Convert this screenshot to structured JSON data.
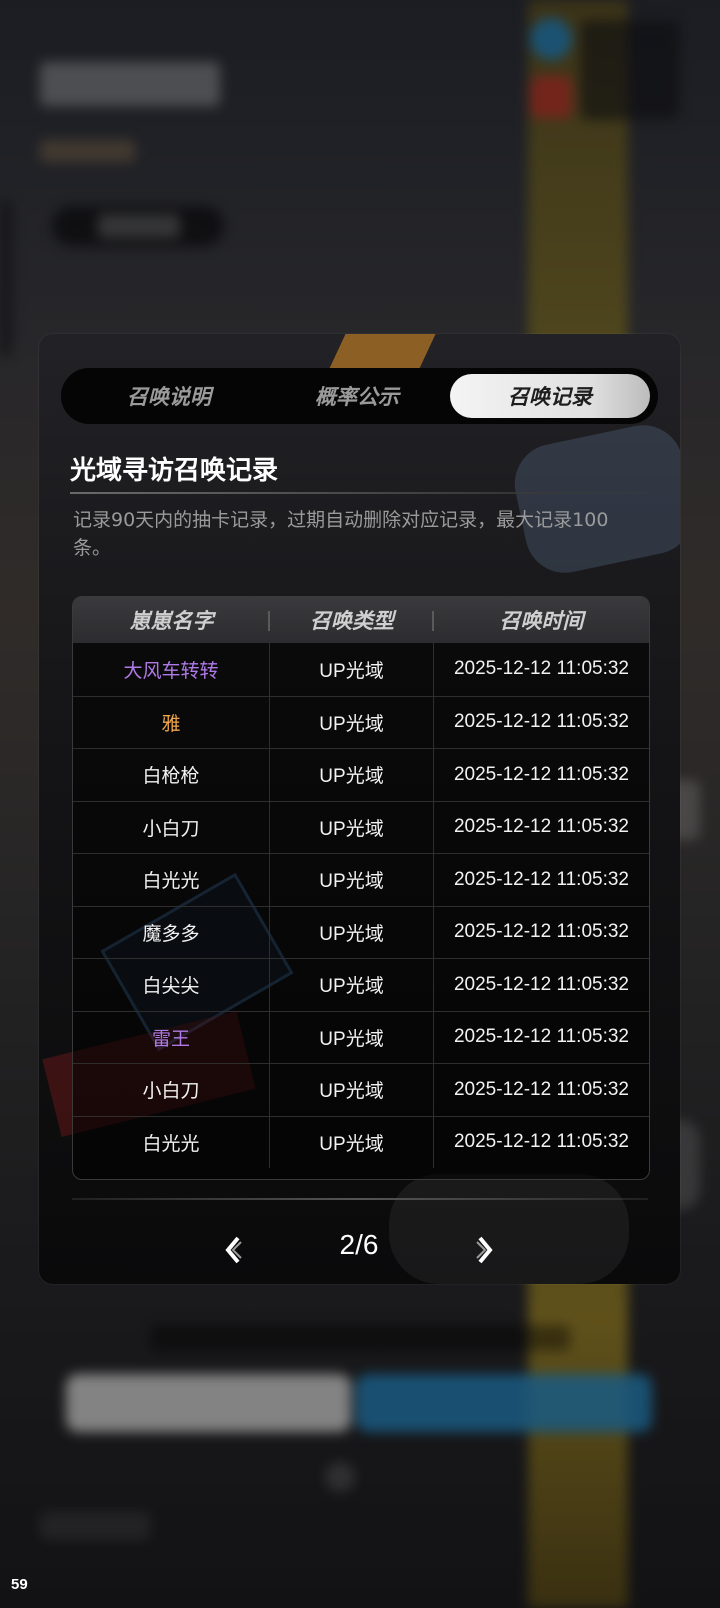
{
  "status": {
    "fps": "59"
  },
  "dialog": {
    "tabs": [
      {
        "label": "召唤说明",
        "active": false
      },
      {
        "label": "概率公示",
        "active": false
      },
      {
        "label": "召唤记录",
        "active": true
      }
    ],
    "title": "光域寻访召唤记录",
    "description": "记录90天内的抽卡记录，过期自动删除对应记录，最大记录100条。",
    "table": {
      "headers": [
        "崽崽名字",
        "召唤类型",
        "召唤时间"
      ],
      "rows": [
        {
          "name": "大风车转转",
          "type": "UP光域",
          "time": "2025-12-12 11:05:32",
          "name_color": "#b07ae6"
        },
        {
          "name": "雅",
          "type": "UP光域",
          "time": "2025-12-12 11:05:32",
          "name_color": "#f0a74a"
        },
        {
          "name": "白枪枪",
          "type": "UP光域",
          "time": "2025-12-12 11:05:32",
          "name_color": "#f2f2f2"
        },
        {
          "name": "小白刀",
          "type": "UP光域",
          "time": "2025-12-12 11:05:32",
          "name_color": "#f2f2f2"
        },
        {
          "name": "白光光",
          "type": "UP光域",
          "time": "2025-12-12 11:05:32",
          "name_color": "#f2f2f2"
        },
        {
          "name": "魔多多",
          "type": "UP光域",
          "time": "2025-12-12 11:05:32",
          "name_color": "#f2f2f2"
        },
        {
          "name": "白尖尖",
          "type": "UP光域",
          "time": "2025-12-12 11:05:32",
          "name_color": "#f2f2f2"
        },
        {
          "name": "雷王",
          "type": "UP光域",
          "time": "2025-12-12 11:05:32",
          "name_color": "#b07ae6"
        },
        {
          "name": "小白刀",
          "type": "UP光域",
          "time": "2025-12-12 11:05:32",
          "name_color": "#f2f2f2"
        },
        {
          "name": "白光光",
          "type": "UP光域",
          "time": "2025-12-12 11:05:32",
          "name_color": "#f2f2f2"
        }
      ]
    },
    "pager": {
      "page": "2/6",
      "prev_icon": "chevron-left-icon",
      "next_icon": "chevron-right-icon"
    }
  }
}
